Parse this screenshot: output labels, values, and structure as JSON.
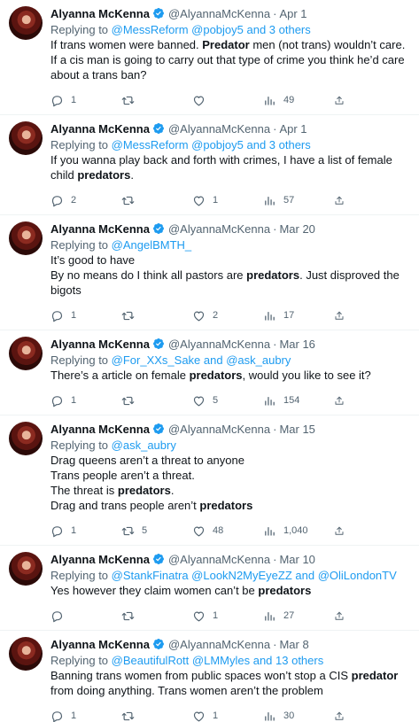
{
  "colors": {
    "accent": "#1d9bf0",
    "muted": "#536471",
    "text": "#0f1419"
  },
  "icons": [
    "reply-icon",
    "retweet-icon",
    "like-icon",
    "views-icon",
    "share-icon",
    "verified-icon"
  ],
  "tweets": [
    {
      "name": "Alyanna McKenna",
      "handle": "@AlyannaMcKenna",
      "sep": "·",
      "date": "Apr 1",
      "reply_prefix": "Replying to ",
      "reply_links": "@MessReform @pobjoy5 and 3 others",
      "text_html": "If trans women were banned. <b>Predator</b> men (not trans) wouldn’t care. If a cis man is going to carry out that type of crime you think he’d care about a trans ban?",
      "replies": "1",
      "retweets": "",
      "likes": "",
      "views": "49"
    },
    {
      "name": "Alyanna McKenna",
      "handle": "@AlyannaMcKenna",
      "sep": "·",
      "date": "Apr 1",
      "reply_prefix": "Replying to ",
      "reply_links": "@MessReform @pobjoy5 and 3 others",
      "text_html": "If you wanna play back and forth with crimes, I have a list of female child <b>predators</b>.",
      "replies": "2",
      "retweets": "",
      "likes": "1",
      "views": "57"
    },
    {
      "name": "Alyanna McKenna",
      "handle": "@AlyannaMcKenna",
      "sep": "·",
      "date": "Mar 20",
      "reply_prefix": "Replying to ",
      "reply_links": "@AngelBMTH_",
      "text_html": "It’s good to have<br>By no means do I think all pastors are <b>predators</b>. Just disproved the bigots",
      "replies": "1",
      "retweets": "",
      "likes": "2",
      "views": "17"
    },
    {
      "name": "Alyanna McKenna",
      "handle": "@AlyannaMcKenna",
      "sep": "·",
      "date": "Mar 16",
      "reply_prefix": "Replying to ",
      "reply_links": "@For_XXs_Sake and @ask_aubry",
      "text_html": "There’s a article on female <b>predators</b>, would you like to see it?",
      "replies": "1",
      "retweets": "",
      "likes": "5",
      "views": "154"
    },
    {
      "name": "Alyanna McKenna",
      "handle": "@AlyannaMcKenna",
      "sep": "·",
      "date": "Mar 15",
      "reply_prefix": "Replying to ",
      "reply_links": "@ask_aubry",
      "text_html": "Drag queens aren’t a threat to anyone<br>Trans people aren’t a threat.<br>The threat is <b>predators</b>.<br>Drag and trans people aren’t <b>predators</b>",
      "replies": "1",
      "retweets": "5",
      "likes": "48",
      "views": "1,040"
    },
    {
      "name": "Alyanna McKenna",
      "handle": "@AlyannaMcKenna",
      "sep": "·",
      "date": "Mar 10",
      "reply_prefix": "Replying to ",
      "reply_links": "@StankFinatra @LookN2MyEyeZZ and @OliLondonTV",
      "text_html": "Yes however they claim women can’t be <b>predators</b>",
      "replies": "",
      "retweets": "",
      "likes": "1",
      "views": "27"
    },
    {
      "name": "Alyanna McKenna",
      "handle": "@AlyannaMcKenna",
      "sep": "·",
      "date": "Mar 8",
      "reply_prefix": "Replying to ",
      "reply_links": "@BeautifulRott @LMMyles and 13 others",
      "text_html": "Banning trans women from public spaces won’t stop a CIS <b>predator</b> from doing anything. Trans women aren’t the problem",
      "replies": "1",
      "retweets": "",
      "likes": "1",
      "views": "30"
    }
  ]
}
